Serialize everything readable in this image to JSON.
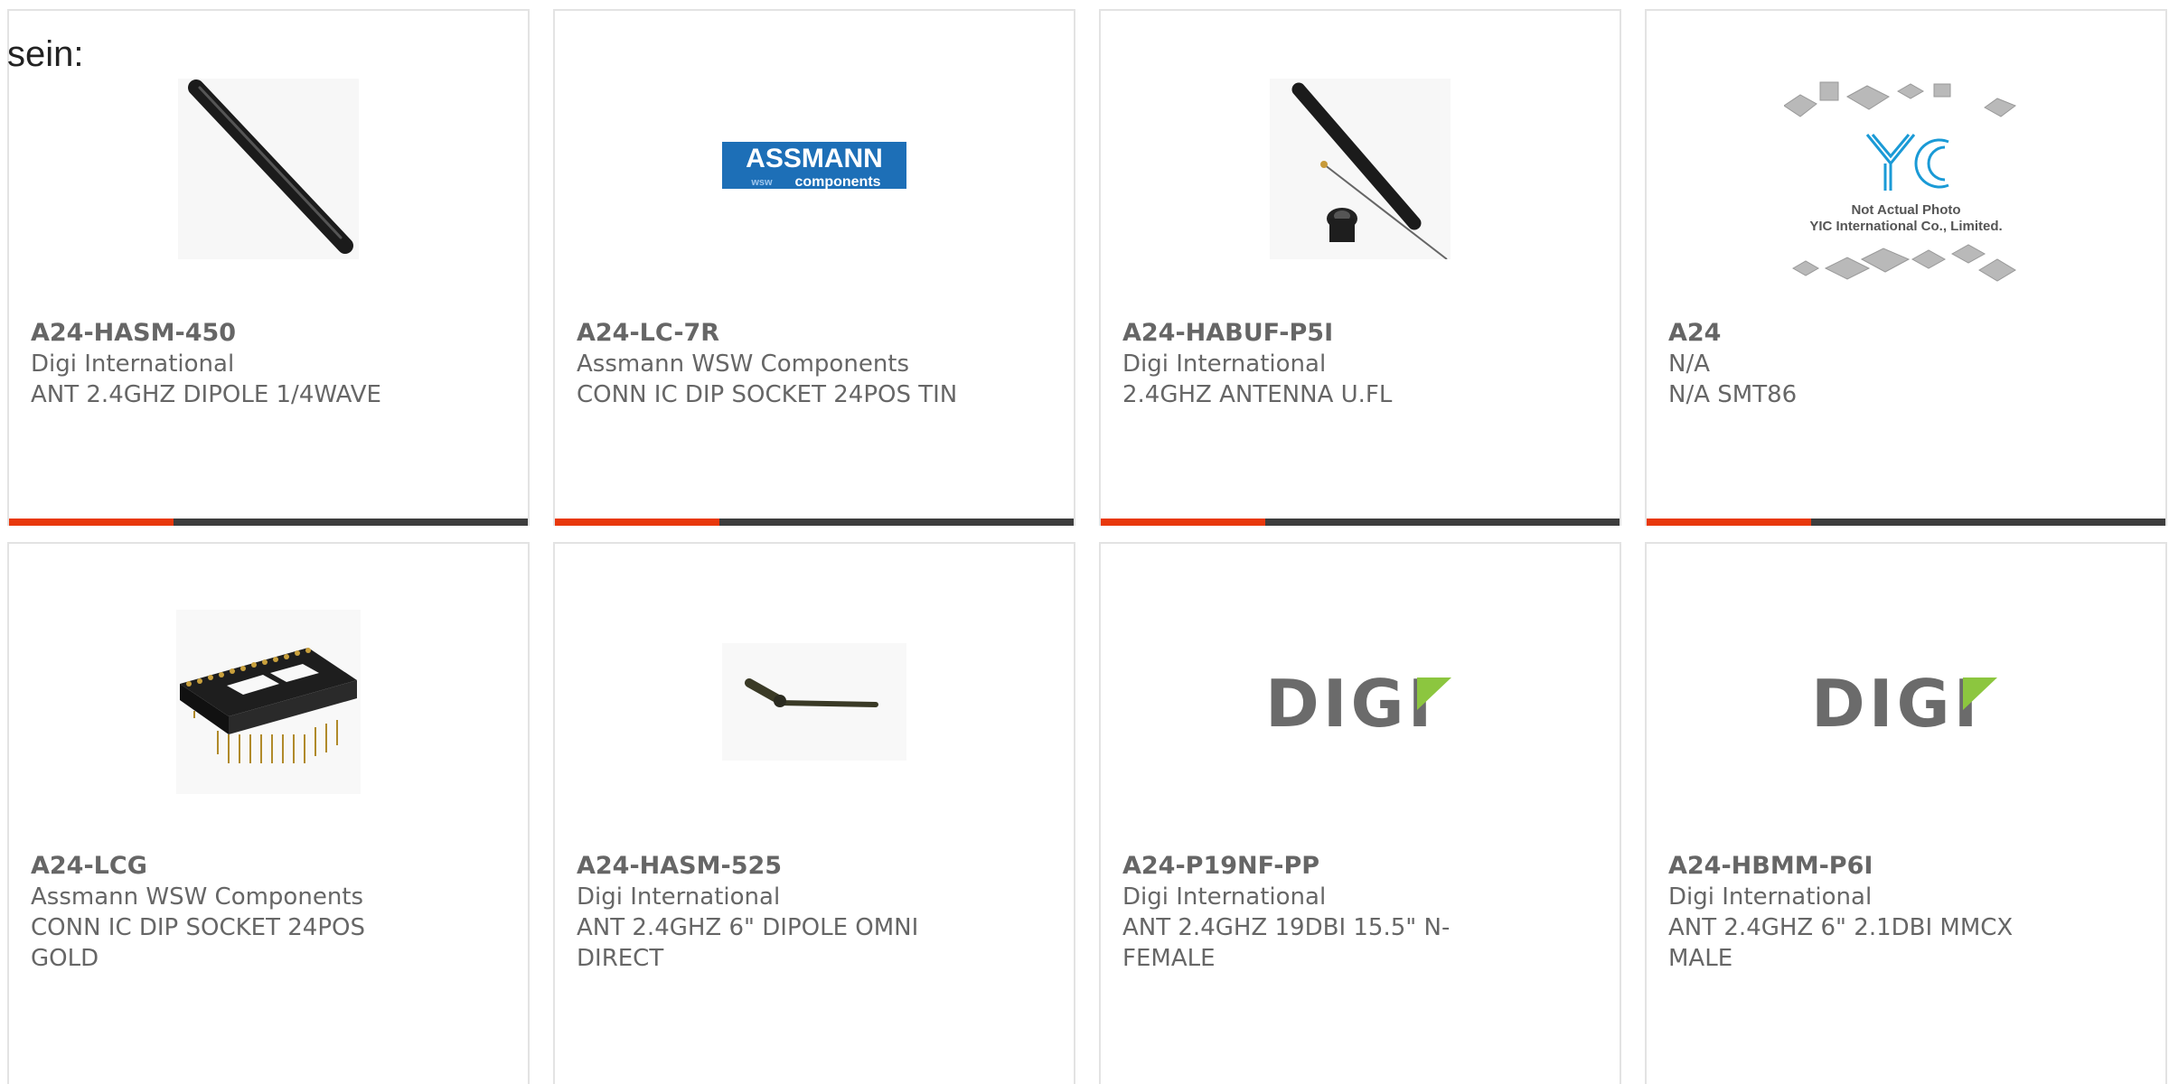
{
  "lead_text": "sein:",
  "colors": {
    "accent": "#e8380c",
    "bar": "#3d3d3d",
    "border": "#e3e3e3",
    "text": "#666666"
  },
  "products": [
    {
      "part_number": "A24-HASM-450",
      "manufacturer": "Digi International",
      "description": "ANT 2.4GHZ DIPOLE 1/4WAVE",
      "image": "black-antenna"
    },
    {
      "part_number": "A24-LC-7R",
      "manufacturer": "Assmann WSW Components",
      "description": "CONN IC DIP SOCKET 24POS TIN",
      "image": "assmann-logo",
      "logo_text": "ASSMANN",
      "logo_sub": "components",
      "logo_prefix": "wsw"
    },
    {
      "part_number": "A24-HABUF-P5I",
      "manufacturer": "Digi International",
      "description": "2.4GHZ ANTENNA U.FL",
      "image": "antenna-with-cable"
    },
    {
      "part_number": "A24",
      "manufacturer": "N/A",
      "description": "N/A SMT86",
      "image": "yic-placeholder",
      "photo_note_1": "Not Actual Photo",
      "photo_note_2": "YIC International Co., Limited.",
      "logo_text": "YIC"
    },
    {
      "part_number": "A24-LCG",
      "manufacturer": "Assmann WSW Components",
      "description": "CONN IC DIP SOCKET 24POS GOLD",
      "image": "dip-socket"
    },
    {
      "part_number": "A24-HASM-525",
      "manufacturer": "Digi International",
      "description": "ANT 2.4GHZ 6\" DIPOLE OMNI DIRECT",
      "image": "swivel-antenna"
    },
    {
      "part_number": "A24-P19NF-PP",
      "manufacturer": "Digi International",
      "description": "ANT 2.4GHZ 19DBI 15.5\" N-FEMALE",
      "image": "digi-logo",
      "logo_text": "DIGI"
    },
    {
      "part_number": "A24-HBMM-P6I",
      "manufacturer": "Digi International",
      "description": "ANT 2.4GHZ 6\" 2.1DBI MMCX MALE",
      "image": "digi-logo",
      "logo_text": "DIGI"
    }
  ]
}
